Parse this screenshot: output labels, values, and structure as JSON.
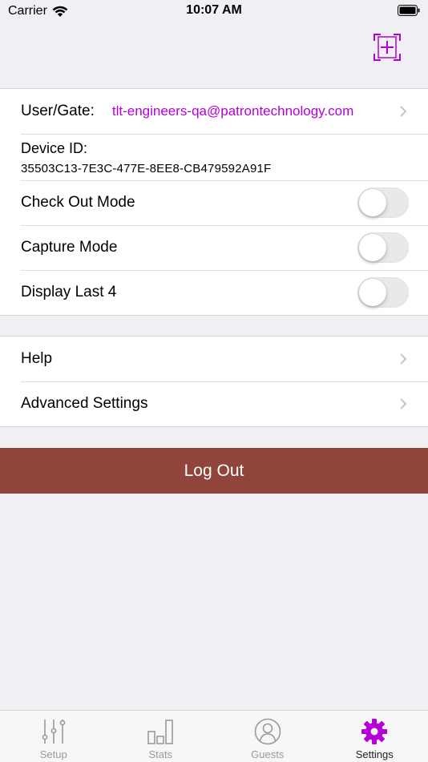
{
  "status_bar": {
    "carrier": "Carrier",
    "time": "10:07 AM"
  },
  "colors": {
    "accent": "#b400d6",
    "logout": "#91443b",
    "inactive_tab": "#9a9a9a"
  },
  "nav": {
    "add_icon": "scan-add-icon"
  },
  "settings": {
    "user_gate_label": "User/Gate:",
    "user_gate_value": "tlt-engineers-qa@patrontechnology.com",
    "device_id_label": "Device ID:",
    "device_id_value": "35503C13-7E3C-477E-8EE8-CB479592A91F",
    "toggles": [
      {
        "label": "Check Out Mode",
        "on": false
      },
      {
        "label": "Capture Mode",
        "on": false
      },
      {
        "label": "Display Last 4",
        "on": false
      }
    ]
  },
  "links": {
    "help": "Help",
    "advanced": "Advanced Settings"
  },
  "logout_label": "Log Out",
  "tabs": [
    {
      "label": "Setup",
      "icon": "sliders-icon",
      "active": false
    },
    {
      "label": "Stats",
      "icon": "bar-chart-icon",
      "active": false
    },
    {
      "label": "Guests",
      "icon": "person-icon",
      "active": false
    },
    {
      "label": "Settings",
      "icon": "gear-icon",
      "active": true
    }
  ]
}
